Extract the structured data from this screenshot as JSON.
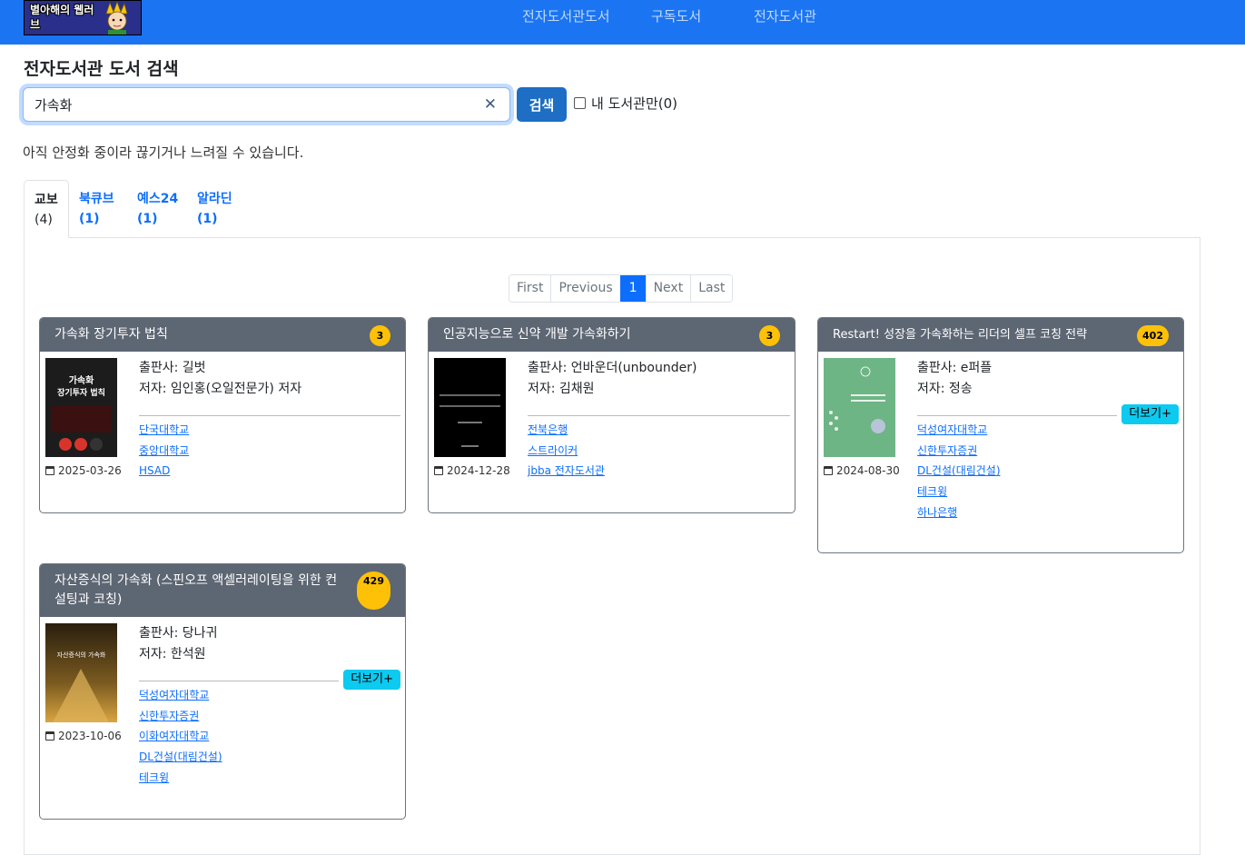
{
  "navbar": {
    "logo_text": "별아해의 웹러브",
    "links": [
      "전자도서관도서",
      "구독도서",
      "전자도서관"
    ]
  },
  "page_title": "전자도서관 도서 검색",
  "search": {
    "value": "가속화",
    "button": "검색",
    "mylib_label": "내 도서관만(0)"
  },
  "notice": "아직 안정화 중이라 끊기거나 느려질 수 있습니다.",
  "tabs": [
    {
      "name": "교보",
      "count": "(4)"
    },
    {
      "name": "북큐브",
      "count": "(1)"
    },
    {
      "name": "예스24",
      "count": "(1)"
    },
    {
      "name": "알라딘",
      "count": "(1)"
    }
  ],
  "pagination": [
    "First",
    "Previous",
    "1",
    "Next",
    "Last"
  ],
  "books": [
    {
      "title": "가속화 장기투자 법칙",
      "badge": "3",
      "publisher": "출판사: 길벗",
      "author": "저자: 임인홍(오일전문가) 저자",
      "date": "2025-03-26",
      "libraries": [
        "단국대학교",
        "중앙대학교",
        "HSAD"
      ],
      "cover_text": "가속화\n장기투자 법칙"
    },
    {
      "title": "인공지능으로 신약 개발 가속화하기",
      "badge": "3",
      "publisher": "출판사: 언바운더(unbounder)",
      "author": "저자: 김채원",
      "date": "2024-12-28",
      "libraries": [
        "전북은행",
        "스트라이커",
        "jbba 전자도서관"
      ]
    },
    {
      "title": "Restart! 성장을 가속화하는 리더의 셀프 코칭 전략",
      "badge": "402",
      "publisher": "출판사: e퍼플",
      "author": "저자: 정송",
      "date": "2024-08-30",
      "libraries": [
        "덕성여자대학교",
        "신한투자증권",
        "DL건설(대림건설)",
        "테크윙",
        "하나은행"
      ],
      "more": "더보기+"
    },
    {
      "title": "자산증식의 가속화 (스핀오프 액셀러레이팅을 위한 컨설팅과 코칭)",
      "badge": "429",
      "publisher": "출판사: 당나귀",
      "author": "저자: 한석원",
      "date": "2023-10-06",
      "libraries": [
        "덕성여자대학교",
        "신한투자증권",
        "이화여자대학교",
        "DL건설(대림건설)",
        "테크윙"
      ],
      "more": "더보기+",
      "cover_text": "자산증식의 가속화"
    }
  ],
  "colors": {
    "navbar": "#1b75f2",
    "card_header": "#5d6673",
    "badge": "#ffc107",
    "more_button": "#0dcaf0",
    "link": "#0d6efd"
  }
}
